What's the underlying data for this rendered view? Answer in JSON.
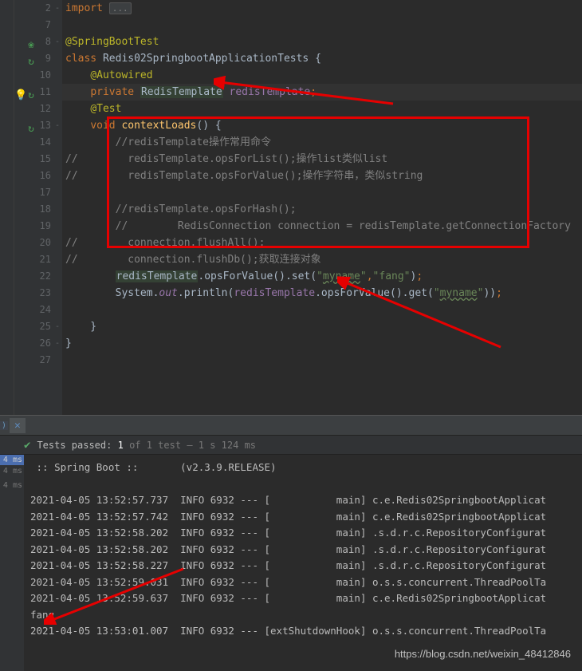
{
  "editor": {
    "lines": [
      {
        "num": 2,
        "fold": "-",
        "tokens": [
          {
            "t": "import ",
            "cls": "kw-orange"
          },
          {
            "t": "...",
            "cls": "fold-box"
          }
        ]
      },
      {
        "num": 7,
        "tokens": []
      },
      {
        "num": 8,
        "icon": "leaf",
        "fold": "-",
        "tokens": [
          {
            "t": "@SpringBootTest",
            "cls": "annotation"
          }
        ]
      },
      {
        "num": 9,
        "icon": "cycle",
        "tokens": [
          {
            "t": "class ",
            "cls": "kw-orange"
          },
          {
            "t": "Redis02SpringbootApplicationTests ",
            "cls": "identifier"
          },
          {
            "t": "{",
            "cls": "plain"
          }
        ]
      },
      {
        "num": 10,
        "tokens": [
          {
            "t": "    ",
            "cls": "plain"
          },
          {
            "t": "@Autowired",
            "cls": "annotation"
          }
        ]
      },
      {
        "num": 11,
        "icon": "cycle",
        "bulb": true,
        "hl": true,
        "tokens": [
          {
            "t": "    ",
            "cls": "plain"
          },
          {
            "t": "private ",
            "cls": "kw-orange"
          },
          {
            "t": "RedisTemplate",
            "cls": "type-hl"
          },
          {
            "t": " ",
            "cls": "plain"
          },
          {
            "t": "redisTemplate",
            "cls": "identifier-purple"
          },
          {
            "t": ";",
            "cls": "kw-orange"
          }
        ]
      },
      {
        "num": 12,
        "tokens": [
          {
            "t": "    ",
            "cls": "plain"
          },
          {
            "t": "@Test",
            "cls": "annotation"
          }
        ]
      },
      {
        "num": 13,
        "icon": "cycle",
        "fold": "-",
        "tokens": [
          {
            "t": "    ",
            "cls": "plain"
          },
          {
            "t": "void ",
            "cls": "kw-orange"
          },
          {
            "t": "contextLoads",
            "cls": "method"
          },
          {
            "t": "() {",
            "cls": "plain"
          }
        ]
      },
      {
        "num": 14,
        "tokens": [
          {
            "t": "        //redisTemplate操作常用命令",
            "cls": "comment"
          }
        ]
      },
      {
        "num": 15,
        "tokens": [
          {
            "t": "//        redisTemplate.opsForList();操作list类似list",
            "cls": "comment"
          }
        ]
      },
      {
        "num": 16,
        "tokens": [
          {
            "t": "//        redisTemplate.opsForValue();操作字符串，类似string",
            "cls": "comment"
          }
        ]
      },
      {
        "num": 17,
        "tokens": []
      },
      {
        "num": 18,
        "tokens": [
          {
            "t": "        //redisTemplate.opsForHash();",
            "cls": "comment"
          }
        ]
      },
      {
        "num": 19,
        "tokens": [
          {
            "t": "        //        RedisConnection connection = redisTemplate.getConnectionFactory",
            "cls": "comment"
          }
        ]
      },
      {
        "num": 20,
        "tokens": [
          {
            "t": "//        connection.flushAll();",
            "cls": "comment"
          }
        ]
      },
      {
        "num": 21,
        "tokens": [
          {
            "t": "//        connection.flushDb();获取连接对象",
            "cls": "comment"
          }
        ]
      },
      {
        "num": 22,
        "tokens": [
          {
            "t": "        ",
            "cls": "plain"
          },
          {
            "t": "redisTemplate",
            "cls": "type-hl"
          },
          {
            "t": ".opsForValue().set(",
            "cls": "plain"
          },
          {
            "t": "\"",
            "cls": "string"
          },
          {
            "t": "myname",
            "cls": "string-underline"
          },
          {
            "t": "\"",
            "cls": "string"
          },
          {
            "t": ",",
            "cls": "kw-orange"
          },
          {
            "t": "\"fang\"",
            "cls": "string"
          },
          {
            "t": ")",
            "cls": "plain"
          },
          {
            "t": ";",
            "cls": "kw-orange"
          }
        ]
      },
      {
        "num": 23,
        "tokens": [
          {
            "t": "        System.",
            "cls": "plain"
          },
          {
            "t": "out",
            "cls": "static-field"
          },
          {
            "t": ".println(",
            "cls": "plain"
          },
          {
            "t": "redisTemplate",
            "cls": "identifier-purple"
          },
          {
            "t": ".opsForValue().get(",
            "cls": "plain"
          },
          {
            "t": "\"",
            "cls": "string"
          },
          {
            "t": "myname",
            "cls": "string-underline"
          },
          {
            "t": "\"",
            "cls": "string"
          },
          {
            "t": "))",
            "cls": "plain"
          },
          {
            "t": ";",
            "cls": "kw-orange"
          }
        ]
      },
      {
        "num": 24,
        "tokens": []
      },
      {
        "num": 25,
        "fold": "-",
        "tokens": [
          {
            "t": "    }",
            "cls": "plain"
          }
        ]
      },
      {
        "num": 26,
        "fold": "-",
        "tokens": [
          {
            "t": "}",
            "cls": "plain"
          }
        ]
      },
      {
        "num": 27,
        "tokens": []
      }
    ]
  },
  "testStatus": {
    "label": "Tests passed:",
    "count": "1",
    "of": "of 1 test",
    "time": "– 1 s 124 ms"
  },
  "timings": [
    "4 ms",
    "4 ms",
    "4 ms"
  ],
  "console": [
    " :: Spring Boot ::       (v2.3.9.RELEASE)",
    "",
    "2021-04-05 13:52:57.737  INFO 6932 --- [           main] c.e.Redis02SpringbootApplicat",
    "2021-04-05 13:52:57.742  INFO 6932 --- [           main] c.e.Redis02SpringbootApplicat",
    "2021-04-05 13:52:58.202  INFO 6932 --- [           main] .s.d.r.c.RepositoryConfigurat",
    "2021-04-05 13:52:58.202  INFO 6932 --- [           main] .s.d.r.c.RepositoryConfigurat",
    "2021-04-05 13:52:58.227  INFO 6932 --- [           main] .s.d.r.c.RepositoryConfigurat",
    "2021-04-05 13:52:59.031  INFO 6932 --- [           main] o.s.s.concurrent.ThreadPoolTa",
    "2021-04-05 13:52:59.637  INFO 6932 --- [           main] c.e.Redis02SpringbootApplicat",
    "fang",
    "2021-04-05 13:53:01.007  INFO 6932 --- [extShutdownHook] o.s.s.concurrent.ThreadPoolTa"
  ],
  "watermark": "https://blog.csdn.net/weixin_48412846",
  "tabLabel": ")"
}
